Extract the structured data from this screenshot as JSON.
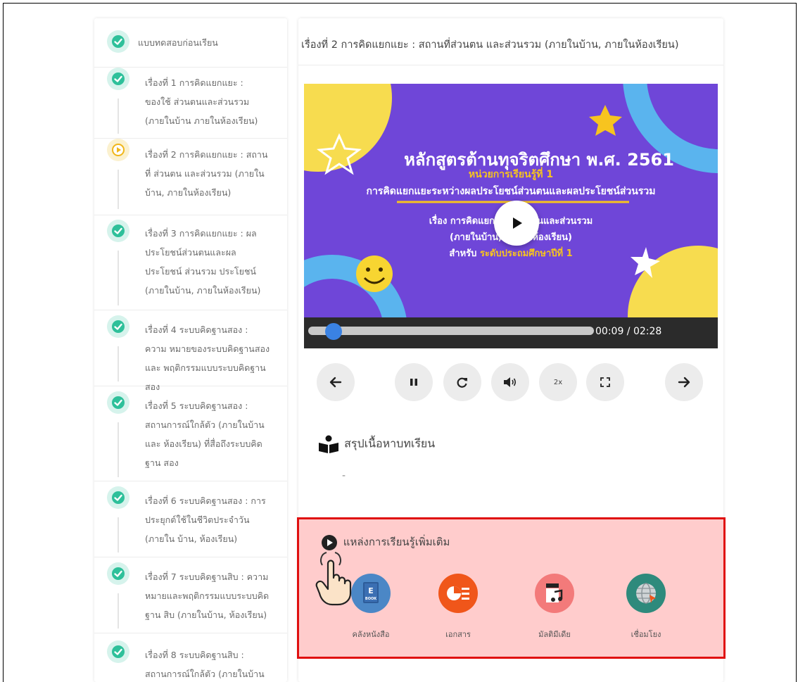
{
  "lessons": [
    {
      "label": "แบบทดสอบก่อนเรียน",
      "status": "done"
    },
    {
      "label": "เรื่องที่ 1 การคิดแยกแยะ : ของใช้ ส่วนตนและส่วนรวม (ภายในบ้าน ภายในห้องเรียน)",
      "status": "done"
    },
    {
      "label": "เรื่องที่ 2 การคิดแยกแยะ : สถานที่ ส่วนตน และส่วนรวม (ภายในบ้าน, ภายในห้องเรียน)",
      "status": "playing"
    },
    {
      "label": "เรื่องที่ 3 การคิดแยกแยะ : ผล ประโยชน์ส่วนตนและผลประโยชน์ ส่วนรวม ประโยชน์ (ภายในบ้าน, ภายในห้องเรียน)",
      "status": "done"
    },
    {
      "label": "เรื่องที่ 4 ระบบคิดฐานสอง : ความ หมายของระบบคิดฐานสองและ พฤติกรรมแบบระบบคิดฐานสอง",
      "status": "done"
    },
    {
      "label": "เรื่องที่ 5 ระบบคิดฐานสอง : สถานการณ์ใกล้ตัว (ภายในบ้าน และ ห้องเรียน) ที่สื่อถึงระบบคิดฐาน สอง",
      "status": "done"
    },
    {
      "label": "เรื่องที่ 6 ระบบคิดฐานสอง : การ ประยุกต์ใช้ในชีวิตประจำวัน (ภายใน บ้าน, ห้องเรียน)",
      "status": "done"
    },
    {
      "label": "เรื่องที่ 7 ระบบคิดฐานสิบ : ความ หมายและพฤติกรรมแบบระบบคิด ฐาน สิบ (ภายในบ้าน, ห้องเรียน)",
      "status": "done"
    },
    {
      "label": "เรื่องที่ 8 ระบบคิดฐานสิบ : สถานการณ์ใกล้ตัว (ภายในบ้าน",
      "status": "done"
    }
  ],
  "main": {
    "title": "เรื่องที่ 2 การคิดแยกแยะ : สถานที่ส่วนตน และส่วนรวม (ภายในบ้าน, ภายในห้องเรียน)"
  },
  "video": {
    "headline": "หลักสูตรต้านทุจริตศึกษา พ.ศ. 2561",
    "unit": "หน่วยการเรียนรู้ที่ 1",
    "subtitle": "การคิดแยกแยะระหว่างผลประโยชน์ส่วนตนและผลประโยชน์ส่วนรวม",
    "line1": "เรื่อง การคิดแยกแยะ ส่วนตนและส่วนรวม",
    "line2": "(ภายในบ้าน, ภายในห้องเรียน)",
    "line3_prefix": "สำหรับ",
    "line3_level": "ระดับประถมศึกษาปีที่ 1",
    "timecode": "00:09 / 02:28",
    "progress": 0.06
  },
  "controls": {
    "prev_icon": "arrow-left-icon",
    "pause_icon": "pause-icon",
    "replay_icon": "replay-icon",
    "volume_icon": "volume-icon",
    "speed_label": "2x",
    "fullscreen_icon": "fullscreen-icon",
    "next_icon": "arrow-right-icon"
  },
  "summary": {
    "title": "สรุปเนื้อหาบทเรียน",
    "content": "-"
  },
  "resources": {
    "title": "แหล่งการเรียนรู้เพิ่มเติม",
    "items": [
      {
        "label": "คลังหนังสือ",
        "color": "#4b87c6",
        "book_text": "BOOK"
      },
      {
        "label": "เอกสาร",
        "color": "#f0561a"
      },
      {
        "label": "มัลติมีเดีย",
        "color": "#f37a7a"
      },
      {
        "label": "เชื่อมโยง",
        "color": "#2e8a7c"
      }
    ]
  },
  "colors": {
    "check_green": "#2ec09a",
    "highlight_border": "#e01010",
    "highlight_fill": "#ffcccc",
    "video_purple": "#6f46d8"
  }
}
